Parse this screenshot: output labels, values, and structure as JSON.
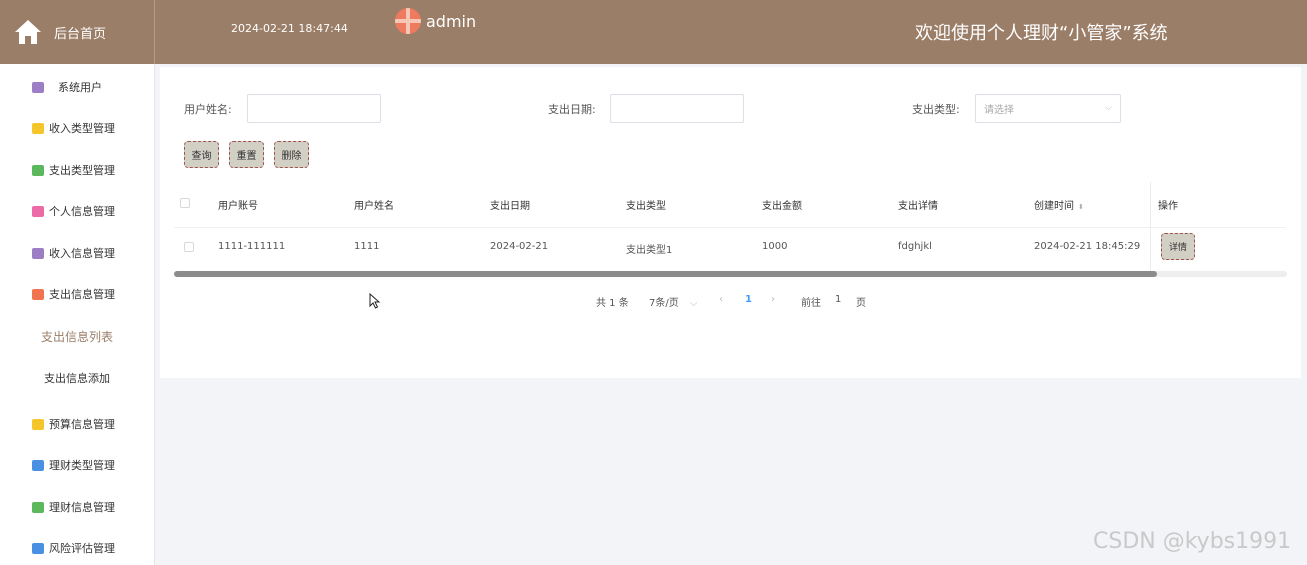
{
  "header": {
    "home_label": "后台首页",
    "datetime": "2024-02-21 18:47:44",
    "user_name": "admin",
    "welcome": "欢迎使用个人理财“小管家”系统"
  },
  "sidebar": {
    "items": [
      {
        "label": "系统用户",
        "icon": "archive-icon",
        "color": "#9b7ec4"
      },
      {
        "label": "收入类型管理",
        "icon": "cube-icon",
        "color": "#f4c629"
      },
      {
        "label": "支出类型管理",
        "icon": "chat-icon",
        "color": "#5cb85c"
      },
      {
        "label": "个人信息管理",
        "icon": "id-card-icon",
        "color": "#ec6aa5"
      },
      {
        "label": "收入信息管理",
        "icon": "archive-icon",
        "color": "#9b7ec4"
      },
      {
        "label": "支出信息管理",
        "icon": "grid-icon",
        "color": "#f0744f"
      }
    ],
    "sub_items": [
      {
        "label": "支出信息列表",
        "active": true
      },
      {
        "label": "支出信息添加",
        "active": false
      }
    ],
    "items2": [
      {
        "label": "预算信息管理",
        "icon": "cube-icon",
        "color": "#f4c629"
      },
      {
        "label": "理财类型管理",
        "icon": "star-icon",
        "color": "#4a90e2"
      },
      {
        "label": "理财信息管理",
        "icon": "chat-icon",
        "color": "#5cb85c"
      },
      {
        "label": "风险评估管理",
        "icon": "star-icon",
        "color": "#4a90e2"
      }
    ]
  },
  "filters": {
    "user_name_label": "用户姓名:",
    "user_name_value": "",
    "date_label": "支出日期:",
    "date_value": "",
    "type_label": "支出类型:",
    "type_placeholder": "请选择"
  },
  "buttons": {
    "query": "查询",
    "reset": "重置",
    "delete": "删除"
  },
  "table": {
    "columns": [
      "用户账号",
      "用户姓名",
      "支出日期",
      "支出类型",
      "支出金额",
      "支出详情",
      "创建时间",
      "操作"
    ],
    "rows": [
      {
        "account": "1111-111111",
        "name": "1111",
        "date": "2024-02-21",
        "type": "支出类型1",
        "amount": "1000",
        "detail": "fdghjkl",
        "created": "2024-02-21 18:45:29",
        "action": "详情"
      }
    ]
  },
  "pagination": {
    "total": "共 1 条",
    "page_size": "7条/页",
    "current_page": "1",
    "goto_label": "前往",
    "goto_value": "1",
    "page_unit": "页"
  },
  "watermark": "CSDN @kybs1991"
}
